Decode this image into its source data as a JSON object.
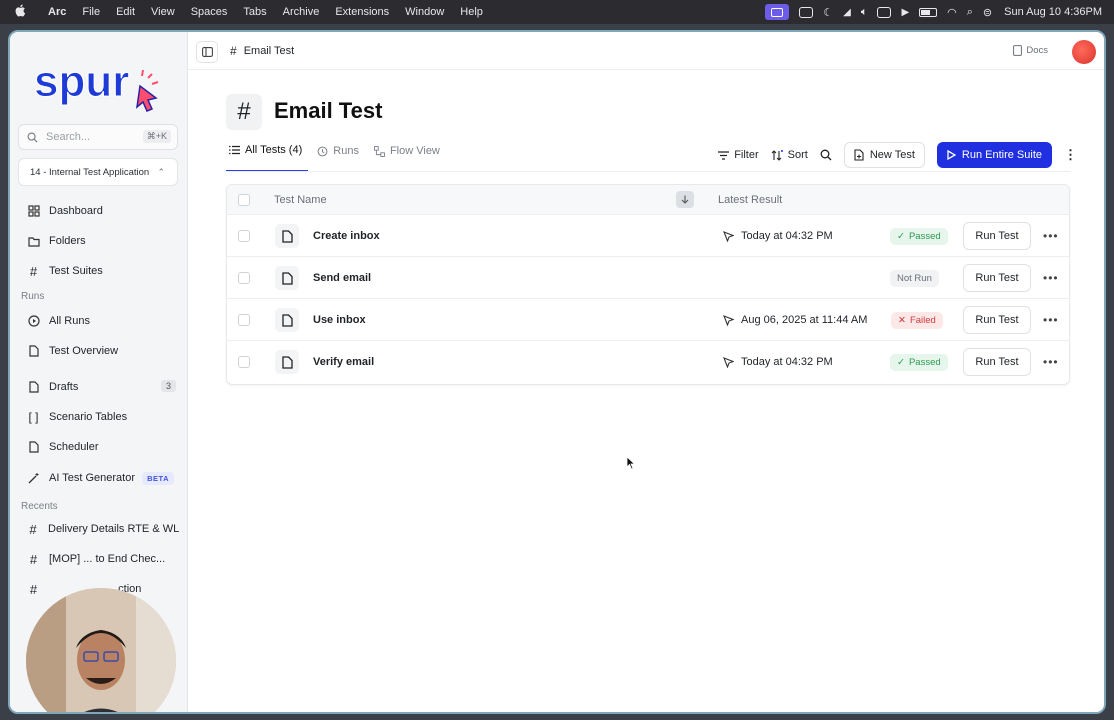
{
  "menubar": {
    "app": "Arc",
    "items": [
      "File",
      "Edit",
      "View",
      "Spaces",
      "Tabs",
      "Archive",
      "Extensions",
      "Window",
      "Help"
    ],
    "datetime": "Sun Aug 10  4:36PM"
  },
  "sidebar": {
    "logo": "spur",
    "search_placeholder": "Search...",
    "search_shortcut": "⌘+K",
    "app_selector": "14 - Internal Test Application",
    "nav": [
      {
        "label": "Dashboard"
      },
      {
        "label": "Folders"
      },
      {
        "label": "Test Suites"
      }
    ],
    "runs_section": "Runs",
    "runs": [
      {
        "label": "All Runs"
      },
      {
        "label": "Test Overview"
      }
    ],
    "drafts": {
      "label": "Drafts",
      "count": "3"
    },
    "scenario_tables": "Scenario Tables",
    "scheduler": "Scheduler",
    "ai_generator": {
      "label": "AI Test Generator",
      "badge": "BETA"
    },
    "recents_section": "Recents",
    "recents": [
      {
        "label": "Delivery Details RTE & WL ..."
      },
      {
        "label": "[MOP] ... to End Chec..."
      },
      {
        "label": "...ction"
      }
    ]
  },
  "topbar": {
    "breadcrumb": "Email Test",
    "docs": "Docs"
  },
  "page": {
    "title": "Email Test",
    "tabs": [
      {
        "label": "All Tests (4)",
        "active": true
      },
      {
        "label": "Runs",
        "active": false
      },
      {
        "label": "Flow View",
        "active": false
      }
    ],
    "actions": {
      "filter": "Filter",
      "sort": "Sort",
      "new_test": "New Test",
      "run_suite": "Run Entire Suite"
    }
  },
  "table": {
    "columns": [
      "Test Name",
      "Latest Result"
    ],
    "rows": [
      {
        "name": "Create inbox",
        "result": "Today at 04:32 PM",
        "status": "Passed",
        "action": "Run Test"
      },
      {
        "name": "Send email",
        "result": "",
        "status": "Not Run",
        "action": "Run Test"
      },
      {
        "name": "Use inbox",
        "result": "Aug 06, 2025 at 11:44 AM",
        "status": "Failed",
        "action": "Run Test"
      },
      {
        "name": "Verify email",
        "result": "Today at 04:32 PM",
        "status": "Passed",
        "action": "Run Test"
      }
    ]
  },
  "colors": {
    "accent": "#2030e0",
    "passed": "#2f9a52",
    "failed": "#d23b3b"
  }
}
